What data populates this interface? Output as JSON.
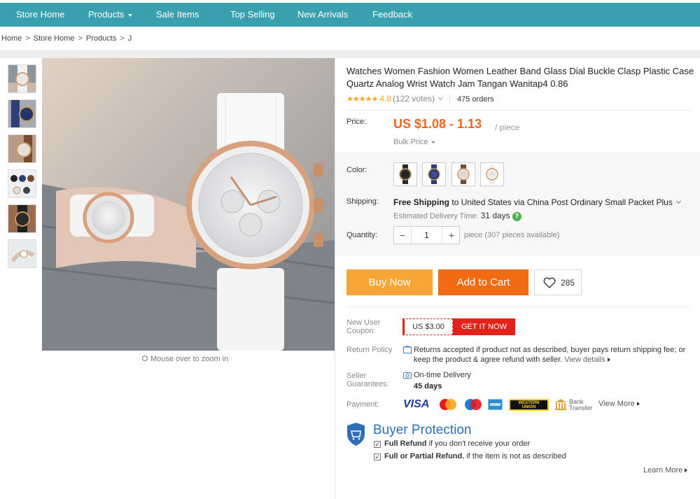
{
  "nav": {
    "items": [
      {
        "label": "Store Home"
      },
      {
        "label": "Products"
      },
      {
        "label": "Sale Items"
      },
      {
        "label": "Top Selling"
      },
      {
        "label": "New Arrivals"
      },
      {
        "label": "Feedback"
      }
    ],
    "bar_color": "#3a9fae"
  },
  "breadcrumb": {
    "items": [
      "Home",
      "Store Home",
      "Products",
      "J"
    ],
    "separator": ">"
  },
  "gallery": {
    "zoom_hint": "Mouse over to zoom in",
    "icon": "magnifier-icon"
  },
  "product": {
    "title": "Watches Women Fashion Women Leather Band Glass Dial Buckle Clasp Plastic Case Quartz Analog Wrist Watch Jam Tangan Wanitap4 0.86",
    "rating_stars": "★★★★★",
    "rating": "4.8",
    "votes": "(122 votes)",
    "orders": "475 orders",
    "price_label": "Price:",
    "price": "US $1.08 - 1.13",
    "per_piece": "/ piece",
    "bulk_price": "Bulk Price",
    "color_label": "Color:",
    "colors": [
      "black",
      "blue",
      "brown",
      "white"
    ],
    "shipping_label": "Shipping:",
    "shipping_bold": "Free Shipping",
    "shipping_rest": "to United States via China Post Ordinary Small Packet Plus",
    "delivery_label": "Estimated Delivery Time:",
    "delivery_days": "31 days",
    "quantity_label": "Quantity:",
    "quantity_minus": "−",
    "quantity_value": "1",
    "quantity_plus": "+",
    "availability": "piece (307 pieces available)",
    "accent_color": "#f0641e"
  },
  "actions": {
    "buy_now": "Buy Now",
    "add_to_cart": "Add to Cart",
    "wishlist_count": "285"
  },
  "coupon": {
    "label": "New User Coupon:",
    "amount": "US $3.00",
    "cta": "GET IT NOW"
  },
  "return_policy": {
    "label": "Return Policy",
    "text": "Returns accepted if product not as described, buyer pays return shipping fee; or keep the product & agree refund with seller.",
    "link": "View details"
  },
  "seller_guarantees": {
    "label": "Seller Guarantees:",
    "item": "On-time Delivery",
    "days": "45 days"
  },
  "payment": {
    "label": "Payment:",
    "methods": [
      "VISA",
      "MasterCard",
      "Maestro",
      "American Express",
      "WESTERN UNION",
      "Bank Transfer"
    ],
    "bank_line1": "Bank",
    "bank_line2": "Transfer",
    "visa": "VISA",
    "wu_line1": "WESTERN",
    "wu_line2": "UNION",
    "view_more": "View More"
  },
  "buyer_protection": {
    "title": "Buyer Protection",
    "line1_bold": "Full Refund",
    "line1_rest": "if you don't receive your order",
    "line2_bold": "Full or Partial Refund",
    "line2_rest": ", if the item is not as described",
    "learn_more": "Learn More"
  }
}
